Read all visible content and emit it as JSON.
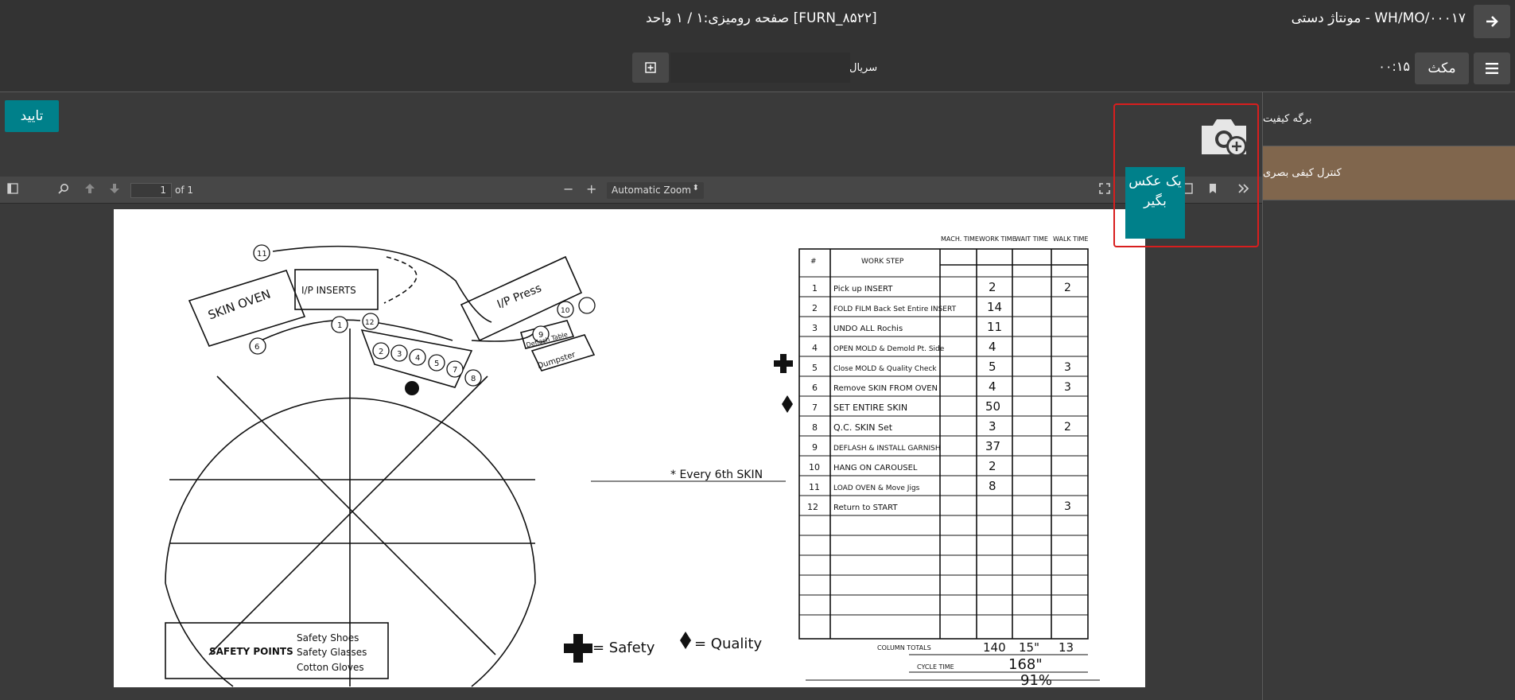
{
  "header": {
    "mo_title": "WH/MO/۰۰۰۱۷ - مونتاژ دستی",
    "center_title": "[FURN_۸۵۲۲] صفحه رومیزی:۱ / ۱ واحد",
    "pause_label": "مکث",
    "timer": "۰۰:۱۵",
    "serial_label": "سریال",
    "serial_value": ""
  },
  "sidebar": {
    "items": [
      {
        "label": "برگه کیفیت"
      },
      {
        "label": "کنترل کیفی بصری"
      }
    ]
  },
  "actions": {
    "confirm_label": "تایید",
    "photo_label": "یک عکس بگیر"
  },
  "viewer": {
    "page_number": "1",
    "page_total": "of 1",
    "zoom": "Automatic Zoom"
  },
  "document": {
    "table_headers": {
      "num": "#",
      "step": "WORK STEP",
      "mach": "MACH. TIME",
      "work": "WORK TIME",
      "wait": "WAIT TIME",
      "walk": "WALK TIME"
    },
    "rows": [
      {
        "n": "1",
        "step": "Pick up INSERT",
        "work": "2",
        "walk": "2"
      },
      {
        "n": "2",
        "step": "FOLD FILM Back Set Entire INSERT",
        "work": "14",
        "walk": ""
      },
      {
        "n": "3",
        "step": "UNDO ALL Rochis",
        "work": "11",
        "walk": ""
      },
      {
        "n": "4",
        "step": "OPEN MOLD & Demold Pt. Side",
        "work": "4",
        "walk": ""
      },
      {
        "n": "5",
        "step": "Close MOLD & Quality Check",
        "work": "5",
        "walk": "3"
      },
      {
        "n": "6",
        "step": "Remove SKIN FROM OVEN",
        "work": "4",
        "walk": "3"
      },
      {
        "n": "7",
        "step": "SET ENTIRE SKIN",
        "work": "50",
        "walk": ""
      },
      {
        "n": "8",
        "step": "Q.C. SKIN Set",
        "work": "3",
        "walk": "2"
      },
      {
        "n": "9",
        "step": "DEFLASH & INSTALL GARNISH",
        "work": "37",
        "walk": ""
      },
      {
        "n": "10",
        "step": "HANG ON CAROUSEL",
        "work": "2",
        "walk": ""
      },
      {
        "n": "11",
        "step": "LOAD OVEN & Move Jigs",
        "work": "8",
        "walk": ""
      },
      {
        "n": "12",
        "step": "Return to START",
        "work": "",
        "walk": "3"
      }
    ],
    "column_totals_label": "COLUMN TOTALS",
    "totals": {
      "work": "140",
      "wait": "15\"",
      "walk": "13"
    },
    "cycle_time_label": "CYCLE TIME",
    "cycle_time": "168\"",
    "efficiency": "91%",
    "every_note": "* Every 6th SKIN",
    "legend_safety": "= Safety",
    "legend_quality": "= Quality",
    "safety_points_label": "SAFETY POINTS",
    "safety_items": [
      "Safety Shoes",
      "Safety Glasses",
      "Cotton Gloves"
    ],
    "stations": {
      "skin_oven": "SKIN OVEN",
      "ip_inserts": "I/P INSERTS",
      "ip_press": "I/P Press",
      "deflash": "Deflash Table",
      "dumpster": "Dumpster"
    },
    "circle_numbers": [
      "1",
      "2",
      "3",
      "4",
      "5",
      "6",
      "7",
      "8",
      "9",
      "10",
      "11",
      "12"
    ]
  }
}
